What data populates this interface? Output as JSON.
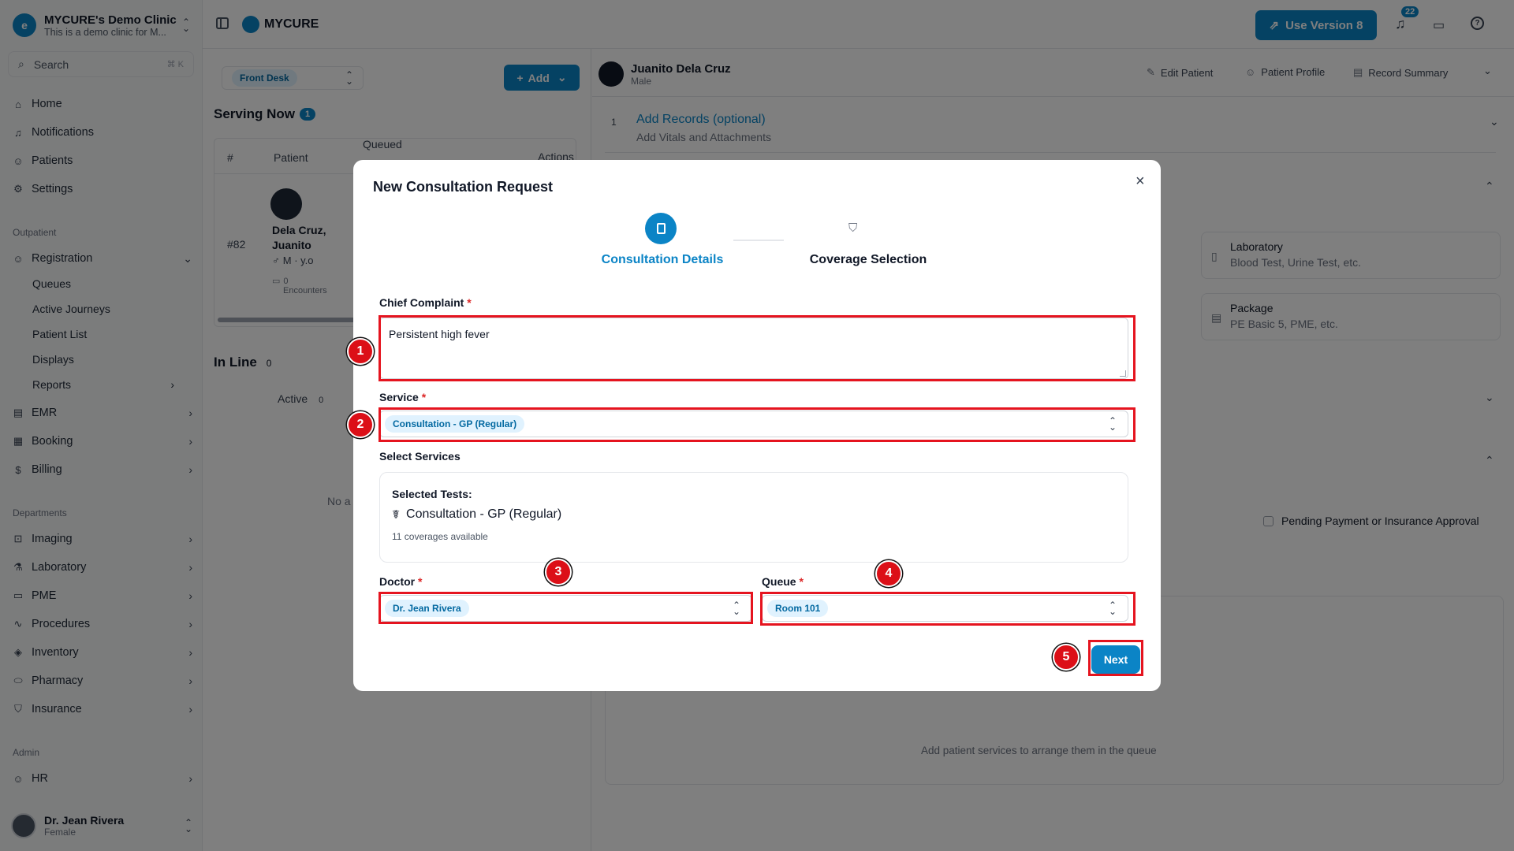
{
  "clinic": {
    "name": "MYCURE's Demo Clinic",
    "subtitle": "This is a demo clinic for M..."
  },
  "search": {
    "placeholder": "Search",
    "shortcut": "⌘ K"
  },
  "sidebar": {
    "main_items": [
      {
        "label": "Home",
        "icon": "home-icon"
      },
      {
        "label": "Notifications",
        "icon": "bell-icon"
      },
      {
        "label": "Patients",
        "icon": "users-icon"
      },
      {
        "label": "Settings",
        "icon": "gear-icon"
      }
    ],
    "outpatient_section": "Outpatient",
    "registration": "Registration",
    "registration_sub": [
      "Queues",
      "Active Journeys",
      "Patient List",
      "Displays",
      "Reports"
    ],
    "outpatient_items": [
      "EMR",
      "Booking",
      "Billing"
    ],
    "departments_section": "Departments",
    "department_items": [
      "Imaging",
      "Laboratory",
      "PME",
      "Procedures",
      "Inventory",
      "Pharmacy",
      "Insurance"
    ],
    "admin_section": "Admin",
    "admin_items": [
      "HR"
    ],
    "user": {
      "name": "Dr. Jean Rivera",
      "sub": "Female"
    }
  },
  "topbar": {
    "brand": "MYCURE",
    "use_version": "Use Version 8",
    "notif_count": "22"
  },
  "queue_panel": {
    "station": "Front Desk",
    "add_label": "Add",
    "serving_now": "Serving Now",
    "serving_count": "1",
    "columns": [
      "#",
      "Patient",
      "Queued",
      "Actions"
    ],
    "row": {
      "num": "#82",
      "name_line1": "Dela Cruz,",
      "name_line2": "Juanito",
      "meta": "M · y.o",
      "encounters_count": "0",
      "encounters_label": "Encounters"
    },
    "in_line": "In Line",
    "in_line_count": "0",
    "active_tab": "Active",
    "active_count": "0",
    "empty_text": "No a"
  },
  "patient_panel": {
    "name": "Juanito Dela Cruz",
    "sex": "Male",
    "actions": [
      "Edit Patient",
      "Patient Profile",
      "Record Summary"
    ],
    "step_num": "1",
    "step_title": "Add Records (optional)",
    "step_sub": "Add Vitals and Attachments",
    "cards": [
      {
        "title": "Laboratory",
        "sub": "Blood Test, Urine Test, etc."
      },
      {
        "title": "Package",
        "sub": "PE Basic 5, PME, etc."
      }
    ],
    "pending_label": "Pending Payment or Insurance Approval",
    "queue_hint": "Add patient services to arrange them in the queue"
  },
  "modal": {
    "title": "New Consultation Request",
    "steps": [
      "Consultation Details",
      "Coverage Selection"
    ],
    "chief_complaint_label": "Chief Complaint",
    "chief_complaint_value": "Persistent high fever",
    "service_label": "Service",
    "service_value": "Consultation - GP (Regular)",
    "select_services_label": "Select Services",
    "selected_tests_label": "Selected Tests:",
    "selected_test": "Consultation - GP (Regular)",
    "coverages": "11 coverages available",
    "doctor_label": "Doctor",
    "doctor_value": "Dr. Jean Rivera",
    "queue_label": "Queue",
    "queue_value": "Room 101",
    "next_label": "Next",
    "required_mark": "*"
  },
  "annotations": [
    "1",
    "2",
    "3",
    "4",
    "5"
  ],
  "colors": {
    "accent": "#0b84c6",
    "highlight": "#e5141f",
    "marker": "#dc0f17"
  }
}
